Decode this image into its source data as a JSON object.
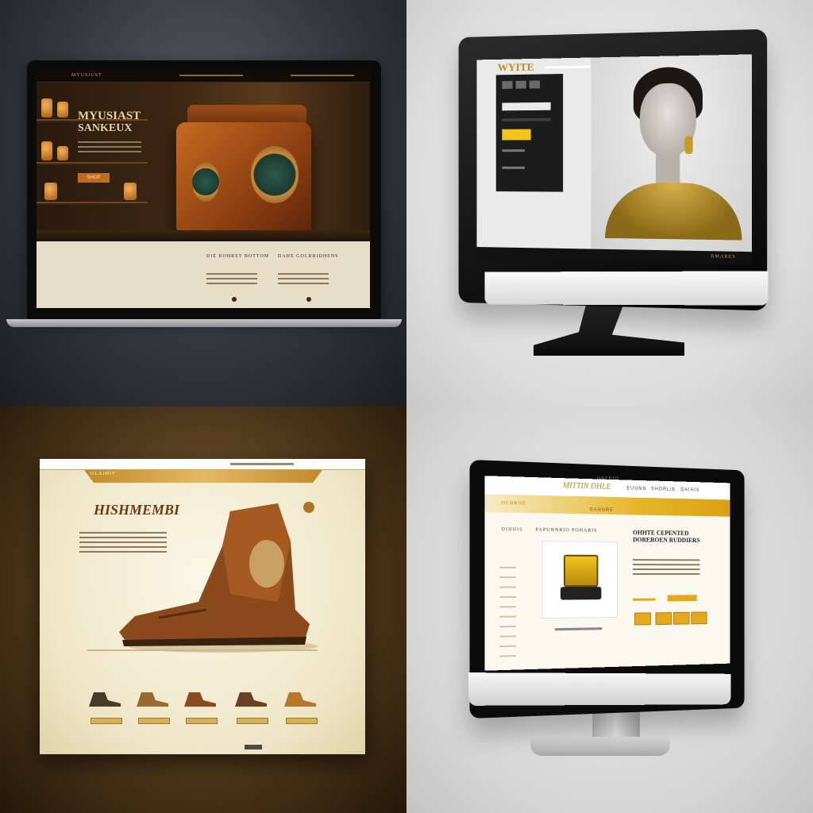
{
  "q1": {
    "brand": "MYUSIUST",
    "hero_title_line1": "MYUSIAST",
    "hero_title_line2": "SANKEUX",
    "hero_button": "SHOP",
    "info_col1_title": "DIE ROHRET BOTTOM",
    "info_col2_title": "DAHE GOLRRIDHENS",
    "colors": {
      "leather": "#b8601e",
      "cream": "#e8dfc9",
      "dark": "#1b130c"
    }
  },
  "q2": {
    "logo": "WYITE",
    "footer_brand": "BMARES",
    "colors": {
      "accent_yellow": "#f2c41c",
      "sidebar": "#1c1c1c"
    }
  },
  "q3": {
    "banner_label": "OLAJHIT",
    "title": "HISHMEMBI",
    "colors": {
      "gold": "#c08a2a",
      "paper": "#fbf7e6"
    }
  },
  "q4": {
    "logo": "OSTRIO",
    "brand": "MITTIN DHLE",
    "nav": [
      "EUUNN",
      "SHORLIE",
      "DAIHIS"
    ],
    "tagline": "OCHRNE",
    "sub_bar": "SAHNRE",
    "section_label": "DIHHIS",
    "product_title": "PAPUNNRIO POHARIS",
    "detail_title_line1": "OHHTE CEPENTED",
    "detail_title_line2": "DOREROEN RUDDIERS",
    "colors": {
      "accent": "#e4a81a",
      "page": "#fbf8ef"
    }
  }
}
